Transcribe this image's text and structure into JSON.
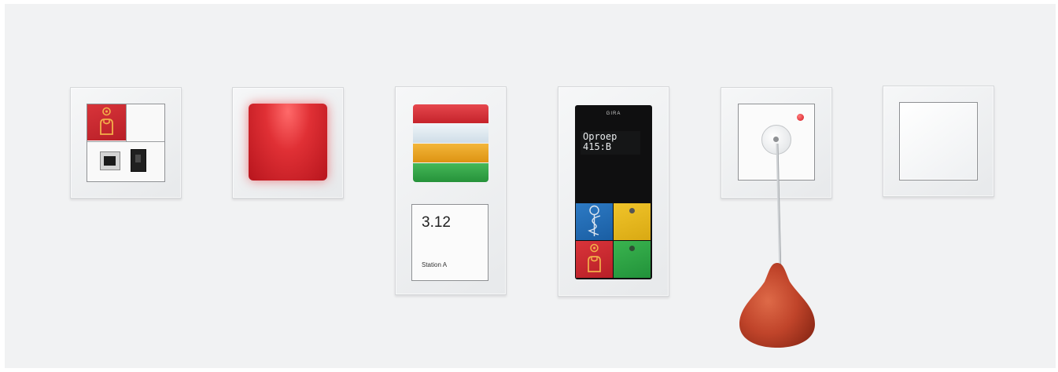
{
  "room_display": {
    "number": "3.12",
    "station": "Station A"
  },
  "call_display": {
    "brand": "GIRA",
    "line1": "Oproep",
    "line2": "415:B"
  },
  "colors": {
    "background": "#f1f2f3",
    "frame": "#eceef0",
    "red": "#c8252d",
    "white_lens": "#dfe9f0",
    "amber": "#e9a21a",
    "green": "#2fa444",
    "blue": "#1f6bb5",
    "yellow": "#e8b91b",
    "pear": "#c0442a"
  },
  "icons": [
    "person-icon",
    "caduceus-icon",
    "network-port-icon",
    "phone-jack-icon",
    "pull-cord-icon"
  ]
}
